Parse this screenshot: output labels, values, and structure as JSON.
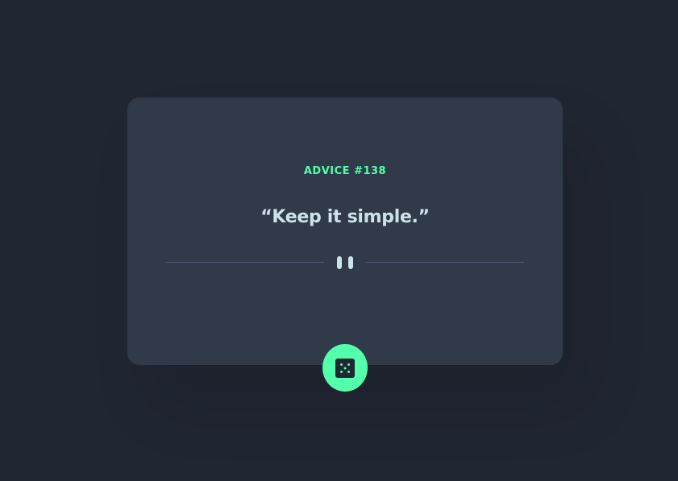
{
  "advice": {
    "id_label": "ADVICE #138",
    "text": "“Keep it simple.”"
  },
  "icons": {
    "divider": "pause-icon",
    "button": "dice-icon"
  },
  "colors": {
    "background": "#202632",
    "card": "#313a48",
    "accent": "#53ffaa",
    "text": "#cee3e9",
    "divider": "#4f5d74"
  }
}
